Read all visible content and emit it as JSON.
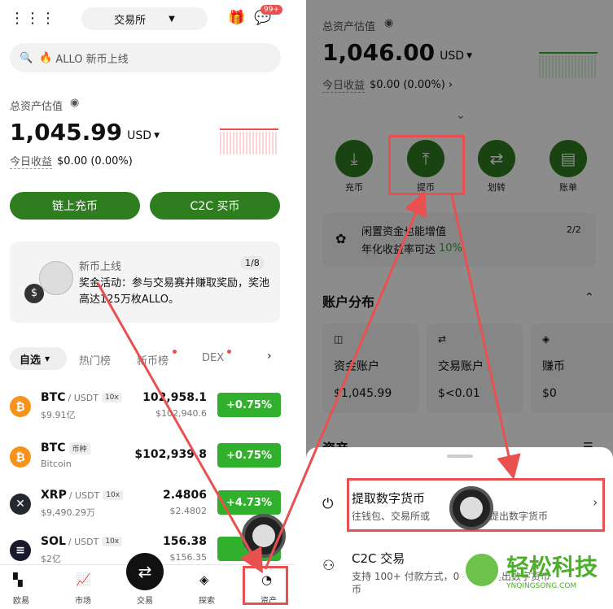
{
  "left": {
    "header": {
      "exchange_label": "交易所",
      "notification_count": "99+"
    },
    "search": {
      "placeholder": "ALLO 新币上线"
    },
    "assets": {
      "title": "总资产估值",
      "value": "1,045.99",
      "currency": "USD",
      "pnl_label": "今日收益",
      "pnl_value": "$0.00 (0.00%)"
    },
    "actions": {
      "deposit": "链上充币",
      "c2c": "C2C 买币"
    },
    "banner": {
      "title": "新币上线",
      "page": "1/8",
      "text": "奖金活动：参与交易赛并赚取奖励，奖池高达125万枚ALLO。"
    },
    "tabs": [
      "自选",
      "热门榜",
      "新币榜",
      "DEX"
    ],
    "coins": [
      {
        "symbol": "BTC",
        "pair": "/ USDT",
        "tag": "10x",
        "volume": "$9.91亿",
        "price": "102,958.1",
        "sub_price": "$102,940.6",
        "change": "+0.75%",
        "color": "#f7931a",
        "icon": "bitcoin-icon"
      },
      {
        "symbol": "BTC",
        "pair": "",
        "tag": "币种",
        "volume": "Bitcoin",
        "price": "$102,939.8",
        "sub_price": "",
        "change": "+0.75%",
        "color": "#f7931a",
        "icon": "bitcoin-icon"
      },
      {
        "symbol": "XRP",
        "pair": "/ USDT",
        "tag": "10x",
        "volume": "$9,490.29万",
        "price": "2.4806",
        "sub_price": "$2.4802",
        "change": "+4.73%",
        "color": "#23292f",
        "icon": "xrp-icon"
      },
      {
        "symbol": "SOL",
        "pair": "/ USDT",
        "tag": "10x",
        "volume": "$2亿",
        "price": "156.38",
        "sub_price": "$156.35",
        "change": "+",
        "color": "#1a1a2e",
        "icon": "solana-icon"
      }
    ],
    "nav": [
      "欧易",
      "市场",
      "交易",
      "探索",
      "资产"
    ]
  },
  "right": {
    "assets": {
      "title": "总资产估值",
      "value": "1,046.00",
      "currency": "USD",
      "pnl_label": "今日收益",
      "pnl_value": "$0.00 (0.00%)"
    },
    "quick_actions": [
      "充币",
      "提币",
      "划转",
      "账单"
    ],
    "promo": {
      "title": "闲置资金也能增值",
      "sub": "年化收益率可达",
      "rate": "10%",
      "page": "2/2"
    },
    "distribution": {
      "title": "账户分布"
    },
    "accounts": [
      {
        "name": "资金账户",
        "value": "$1,045.99"
      },
      {
        "name": "交易账户",
        "value": "$<0.01"
      },
      {
        "name": "赚币",
        "value": "$0"
      }
    ],
    "assets_label": "资产",
    "sheet": [
      {
        "title": "提取数字货币",
        "desc": "往钱包、交易所或",
        "desc2": "提出数字货币"
      },
      {
        "title": "C2C 交易",
        "desc": "支持 100+ 付款方式，0 手续费卖出数字货币",
        "desc2": "币"
      }
    ]
  },
  "watermark": {
    "name": "轻松科技",
    "url": "YNQINGSONG.COM"
  },
  "colors": {
    "brand_green": "#2e7d1f",
    "up_green": "#31b02e",
    "annotation_red": "#e8514f"
  }
}
